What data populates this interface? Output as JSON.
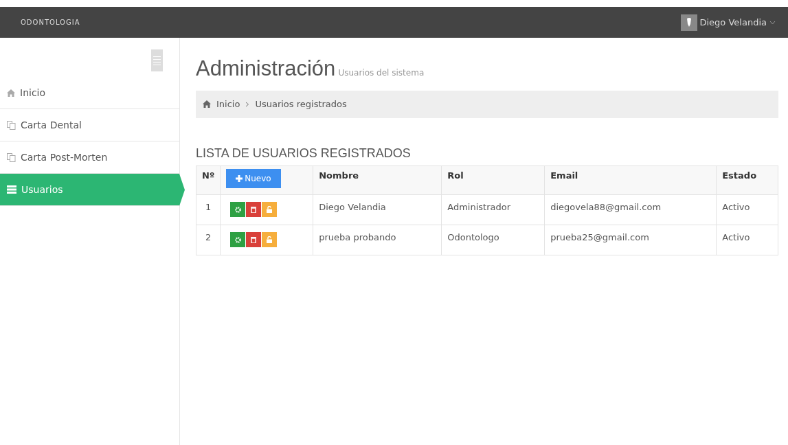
{
  "navbar": {
    "brand": "ODONTOLOGIA",
    "user": "Diego Velandia"
  },
  "sidebar": {
    "items": [
      {
        "label": "Inicio",
        "kind": "home",
        "selected": false
      },
      {
        "label": "Carta Dental",
        "kind": "page",
        "selected": false
      },
      {
        "label": "Carta Post-Morten",
        "kind": "page",
        "selected": false
      },
      {
        "label": "Usuarios",
        "kind": "list",
        "selected": true
      }
    ]
  },
  "header": {
    "title": "Administración",
    "subtitle": "Usuarios del sistema"
  },
  "breadcrumb": [
    "Inicio",
    "Usuarios registrados"
  ],
  "section_title": "LISTA DE USUARIOS REGISTRADOS",
  "table": {
    "columns": [
      "Nº",
      "Nuevo",
      "Nombre",
      "Rol",
      "Email",
      "Estado"
    ],
    "rows": [
      {
        "number": "1",
        "name": "Diego Velandia",
        "role": "Administrador",
        "email": "diegovela88@gmail.com",
        "status": "Activo"
      },
      {
        "number": "2",
        "name": "prueba probando",
        "role": "Odontologo",
        "email": "prueba25@gmail.com",
        "status": "Activo"
      }
    ]
  }
}
